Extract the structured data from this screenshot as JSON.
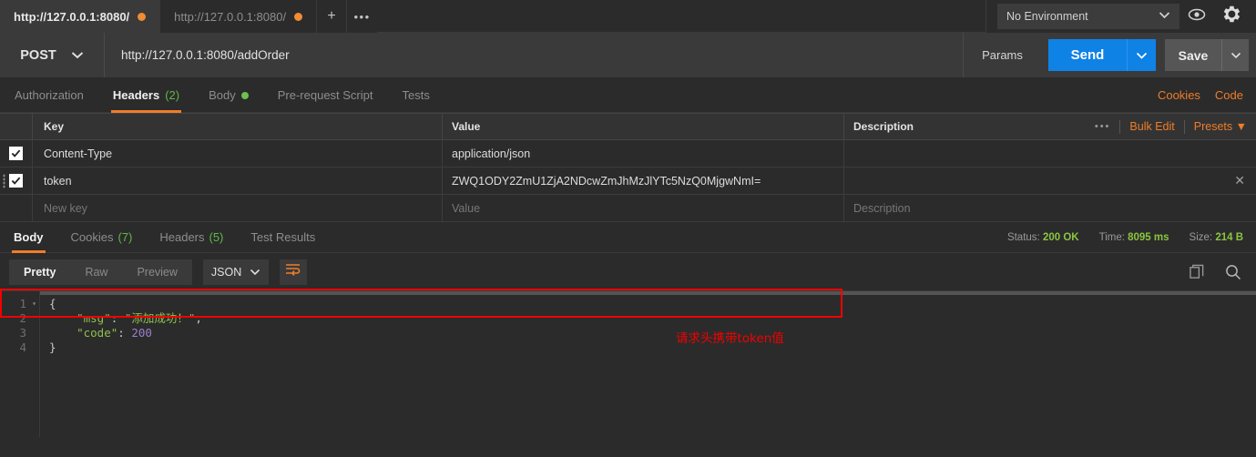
{
  "tabbar": {
    "tabs": [
      {
        "label": "http://127.0.0.1:8080/",
        "active": true,
        "unsaved": true
      },
      {
        "label": "http://127.0.0.1:8080/",
        "active": false,
        "unsaved": true
      }
    ],
    "new_tab_label": "+",
    "more_label": "•••",
    "environment": {
      "selected": "No Environment",
      "caret": "⌄"
    },
    "eye_icon": "eye-icon",
    "gear_icon": "gear-icon"
  },
  "request": {
    "method": "POST",
    "method_caret": "⌄",
    "url": "http://127.0.0.1:8080/addOrder",
    "params_label": "Params",
    "send_label": "Send",
    "send_caret": "⌄",
    "save_label": "Save",
    "save_caret": "⌄"
  },
  "request_tabs": {
    "items": [
      {
        "label": "Authorization",
        "badge": "",
        "dot": false,
        "active": false
      },
      {
        "label": "Headers",
        "badge": "(2)",
        "dot": false,
        "active": true
      },
      {
        "label": "Body",
        "badge": "",
        "dot": true,
        "active": false
      },
      {
        "label": "Pre-request Script",
        "badge": "",
        "dot": false,
        "active": false
      },
      {
        "label": "Tests",
        "badge": "",
        "dot": false,
        "active": false
      }
    ],
    "cookies_label": "Cookies",
    "code_label": "Code"
  },
  "headers_table": {
    "columns": {
      "key": "Key",
      "value": "Value",
      "description": "Description"
    },
    "actions": {
      "dots": "•••",
      "bulk_edit": "Bulk Edit",
      "presets": "Presets ▼"
    },
    "rows": [
      {
        "enabled": true,
        "key": "Content-Type",
        "value": "application/json",
        "description": ""
      },
      {
        "enabled": true,
        "key": "token",
        "value": "ZWQ1ODY2ZmU1ZjA2NDcwZmJhMzJlYTc5NzQ0MjgwNmI=",
        "description": "",
        "highlighted": true,
        "close": "✕"
      }
    ],
    "new_row": {
      "key_placeholder": "New key",
      "value_placeholder": "Value",
      "description_placeholder": "Description"
    }
  },
  "annotation": {
    "text": "请求头携带token值",
    "color": "#f20000"
  },
  "response_tabs": {
    "items": [
      {
        "label": "Body",
        "badge": "",
        "active": true
      },
      {
        "label": "Cookies",
        "badge": "(7)",
        "active": false
      },
      {
        "label": "Headers",
        "badge": "(5)",
        "active": false
      },
      {
        "label": "Test Results",
        "badge": "",
        "active": false
      }
    ],
    "status_label": "Status:",
    "status_value": "200 OK",
    "time_label": "Time:",
    "time_value": "8095 ms",
    "size_label": "Size:",
    "size_value": "214 B"
  },
  "response_controls": {
    "views": [
      {
        "label": "Pretty",
        "active": true
      },
      {
        "label": "Raw",
        "active": false
      },
      {
        "label": "Preview",
        "active": false
      }
    ],
    "format": "JSON",
    "format_caret": "⌄",
    "wrap_icon": "word-wrap-icon",
    "copy_icon": "copy-icon",
    "search_icon": "search-icon"
  },
  "response_body": {
    "lines": [
      {
        "num": "1",
        "fold": "▾",
        "text": "{"
      },
      {
        "num": "2",
        "fold": "",
        "text": "    \"msg\": \"添加成功！\","
      },
      {
        "num": "3",
        "fold": "",
        "text": "    \"code\": 200"
      },
      {
        "num": "4",
        "fold": "",
        "text": "}"
      }
    ],
    "msg_key": "\"msg\"",
    "msg_value": "\"添加成功！\"",
    "code_key": "\"code\"",
    "code_value": "200"
  },
  "colors": {
    "accent_orange": "#ef7d29",
    "send_blue": "#0f82e6",
    "status_green": "#89c540",
    "annotation_red": "#f20000"
  }
}
